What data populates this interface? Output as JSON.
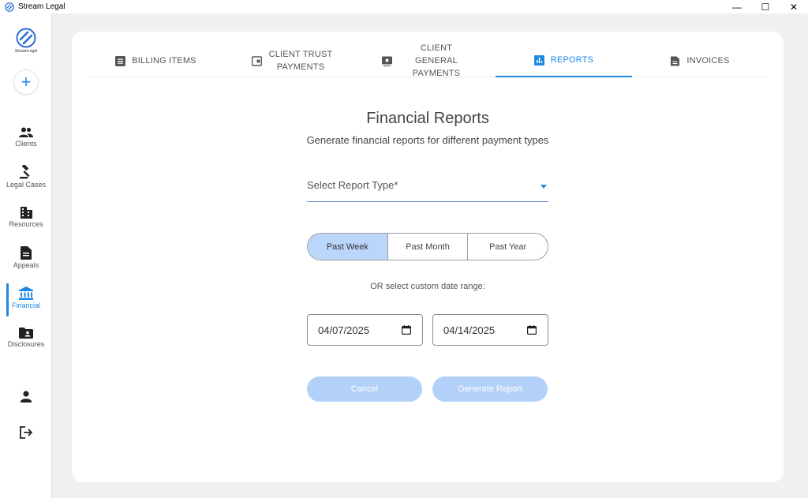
{
  "window": {
    "title": "Stream Legal",
    "controls": [
      "—",
      "☐",
      "✕"
    ]
  },
  "sidebar": {
    "logo_text": "StreamLegal",
    "add_label": "+",
    "items": [
      {
        "label": "Clients",
        "icon": "people-icon"
      },
      {
        "label": "Legal Cases",
        "icon": "gavel-icon"
      },
      {
        "label": "Resources",
        "icon": "building-icon"
      },
      {
        "label": "Appeals",
        "icon": "document-icon"
      },
      {
        "label": "Financial",
        "icon": "bank-icon",
        "active": true
      },
      {
        "label": "Disclosures",
        "icon": "folder-shared-icon"
      }
    ],
    "bottom_icons": [
      "profile-icon",
      "logout-icon"
    ]
  },
  "tabs": [
    {
      "label": "BILLING ITEMS",
      "icon": "list-icon"
    },
    {
      "label": "CLIENT TRUST PAYMENTS",
      "icon": "wallet-icon"
    },
    {
      "label": "CLIENT GENERAL PAYMENTS",
      "icon": "payment-icon"
    },
    {
      "label": "REPORTS",
      "icon": "bar-chart-icon",
      "active": true
    },
    {
      "label": "INVOICES",
      "icon": "invoice-icon"
    }
  ],
  "main": {
    "title": "Financial Reports",
    "subtitle": "Generate financial reports for different payment types",
    "select_placeholder": "Select Report Type*",
    "ranges": [
      "Past Week",
      "Past Month",
      "Past Year"
    ],
    "selected_range": "Past Week",
    "or_text": "OR select custom date range:",
    "start_date": "04/07/2025",
    "end_date": "04/14/2025",
    "cancel_label": "Cancel",
    "generate_label": "Generate Report"
  },
  "colors": {
    "accent": "#1e88e5",
    "toggle_selected": "#bbd6fb",
    "button_disabled": "#b3d1f8"
  }
}
